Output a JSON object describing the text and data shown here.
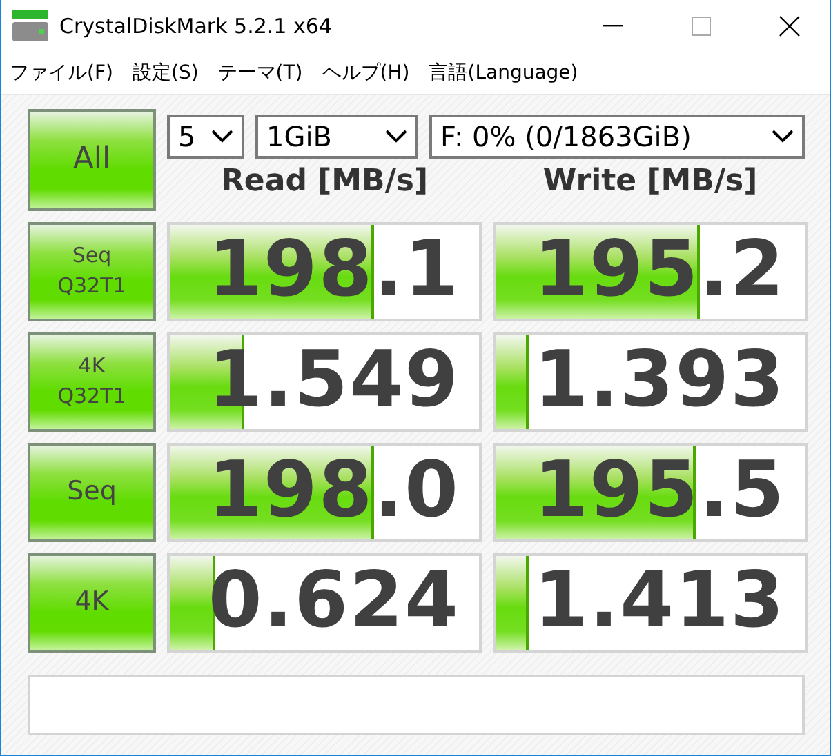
{
  "window": {
    "title": "CrystalDiskMark 5.2.1 x64"
  },
  "menu": [
    "ファイル(F)",
    "設定(S)",
    "テーマ(T)",
    "ヘルプ(H)",
    "言語(Language)"
  ],
  "all_button": "All",
  "selects": [
    {
      "value": "5"
    },
    {
      "value": "1GiB"
    },
    {
      "value": "F: 0% (0/1863GiB)"
    }
  ],
  "columns": [
    "Read [MB/s]",
    "Write [MB/s]"
  ],
  "rows": [
    {
      "lines": [
        "Seq",
        "Q32T1"
      ],
      "results": [
        {
          "value": "198.1",
          "level": 0.65
        },
        {
          "value": "195.2",
          "level": 0.65
        }
      ]
    },
    {
      "lines": [
        "4K",
        "Q32T1"
      ],
      "results": [
        {
          "value": "1.549",
          "level": 0.23
        },
        {
          "value": "1.393",
          "level": 0.1
        }
      ]
    },
    {
      "lines": [
        "Seq"
      ],
      "results": [
        {
          "value": "198.0",
          "level": 0.65
        },
        {
          "value": "195.5",
          "level": 0.64
        }
      ]
    },
    {
      "lines": [
        "4K"
      ],
      "results": [
        {
          "value": "0.624",
          "level": 0.14
        },
        {
          "value": "1.413",
          "level": 0.1
        }
      ]
    }
  ]
}
